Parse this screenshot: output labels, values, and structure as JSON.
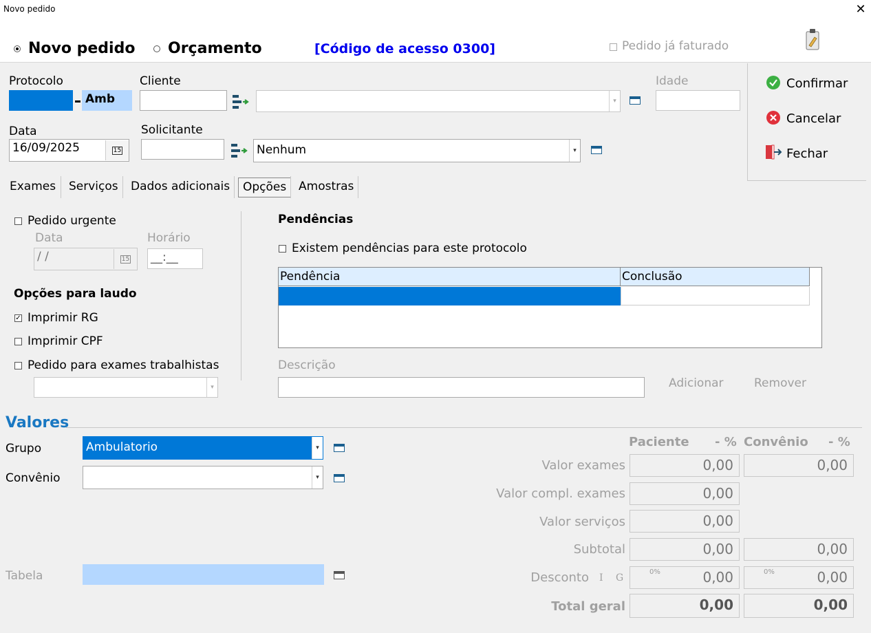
{
  "window": {
    "title": "Novo pedido",
    "close": "✕"
  },
  "header": {
    "mode_novo": "Novo pedido",
    "mode_orcamento": "Orçamento",
    "access_code": "[Código de acesso 0300]",
    "faturado": "Pedido já faturado"
  },
  "form": {
    "protocolo_label": "Protocolo",
    "protocolo_suffix": "Amb",
    "cliente_label": "Cliente",
    "idade_label": "Idade",
    "data_label": "Data",
    "data_value": "16/09/2025",
    "solicitante_label": "Solicitante",
    "solicitante_value": "Nenhum"
  },
  "actions": {
    "confirmar": "Confirmar",
    "cancelar": "Cancelar",
    "fechar": "Fechar"
  },
  "tabs": [
    "Exames",
    "Serviços",
    "Dados adicionais",
    "Opções",
    "Amostras"
  ],
  "opcoes": {
    "urgente": "Pedido urgente",
    "data_label": "Data",
    "data_value": " /  /",
    "horario_label": "Horário",
    "horario_value": "__:__",
    "laudo_title": "Opções para laudo",
    "imprimir_rg": "Imprimir RG",
    "imprimir_cpf": "Imprimir CPF",
    "trabalhistas": "Pedido para exames trabalhistas"
  },
  "pendencias": {
    "title": "Pendências",
    "existem": "Existem pendências para este protocolo",
    "col_pendencia": "Pendência",
    "col_conclusao": "Conclusão",
    "descricao_label": "Descrição",
    "adicionar": "Adicionar",
    "remover": "Remover"
  },
  "valores": {
    "title": "Valores",
    "grupo_label": "Grupo",
    "grupo_value": "Ambulatorio",
    "convenio_label": "Convênio",
    "tabela_label": "Tabela",
    "col_paciente": "Paciente",
    "col_pct1": "- %",
    "col_convenio": "Convênio",
    "col_pct2": "- %",
    "valor_exames": "Valor exames",
    "valor_compl": "Valor compl. exames",
    "valor_servicos": "Valor serviços",
    "subtotal": "Subtotal",
    "desconto": "Desconto",
    "desc_i": "I",
    "desc_g": "G",
    "total": "Total geral",
    "pct_small": "0%",
    "zero": "0,00"
  },
  "icons": {
    "calendar": "15",
    "combo": "▾"
  }
}
